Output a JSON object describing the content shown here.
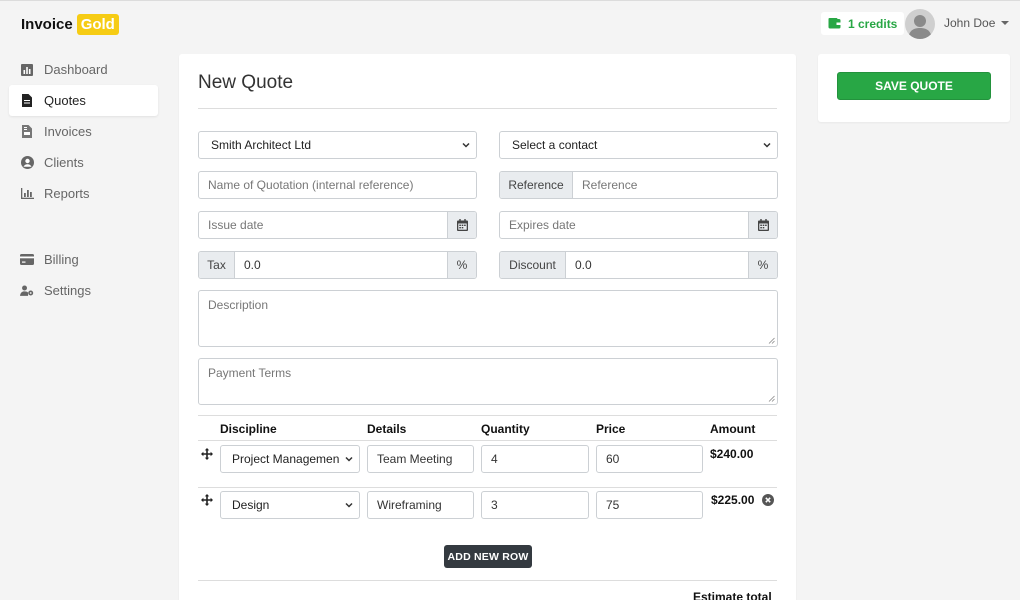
{
  "brand": {
    "name": "Invoice",
    "badge": "Gold"
  },
  "header": {
    "credits": "1 credits",
    "user_name": "John Doe"
  },
  "sidebar": {
    "items": [
      {
        "label": "Dashboard",
        "icon": "chart-icon"
      },
      {
        "label": "Quotes",
        "icon": "document-icon",
        "active": true
      },
      {
        "label": "Invoices",
        "icon": "invoice-icon"
      },
      {
        "label": "Clients",
        "icon": "user-circle-icon"
      },
      {
        "label": "Reports",
        "icon": "bar-chart-icon"
      }
    ],
    "secondary": [
      {
        "label": "Billing",
        "icon": "credit-card-icon"
      },
      {
        "label": "Settings",
        "icon": "user-gear-icon"
      }
    ]
  },
  "form": {
    "title": "New Quote",
    "client_select": "Smith Architect Ltd",
    "contact_select": "Select a contact",
    "quotation_name_placeholder": "Name of Quotation (internal reference)",
    "reference_label": "Reference",
    "reference_placeholder": "Reference",
    "issue_date_placeholder": "Issue date",
    "expires_date_placeholder": "Expires date",
    "tax_label": "Tax",
    "tax_value": "0.0",
    "tax_unit": "%",
    "discount_label": "Discount",
    "discount_value": "0.0",
    "discount_unit": "%",
    "description_placeholder": "Description",
    "payment_terms_placeholder": "Payment Terms"
  },
  "table": {
    "headers": [
      "Discipline",
      "Details",
      "Quantity",
      "Price",
      "Amount"
    ],
    "rows": [
      {
        "discipline": "Project Managemen",
        "details": "Team Meeting",
        "quantity": "4",
        "price": "60",
        "amount": "$240.00"
      },
      {
        "discipline": "Design",
        "details": "Wireframing",
        "quantity": "3",
        "price": "75",
        "amount": "$225.00"
      }
    ],
    "add_row_label": "ADD NEW ROW",
    "estimate_total_label": "Estimate total"
  },
  "actions": {
    "save_label": "SAVE QUOTE"
  },
  "colors": {
    "accent_green": "#28a745",
    "brand_gold": "#f6cc14",
    "dark_button": "#343a40"
  }
}
